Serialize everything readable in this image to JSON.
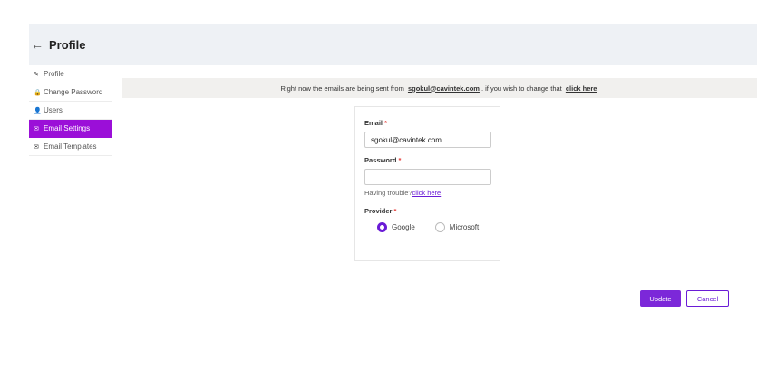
{
  "header": {
    "back_icon": "←",
    "title": "Profile"
  },
  "sidebar": {
    "items": [
      {
        "label": "Profile",
        "icon": "pencil-icon",
        "glyph": "✎",
        "active": false
      },
      {
        "label": "Change Password",
        "icon": "lock-icon",
        "glyph": "🔒",
        "active": false
      },
      {
        "label": "Users",
        "icon": "user-icon",
        "glyph": "👤",
        "active": false
      },
      {
        "label": "Email Settings",
        "icon": "envelope-icon",
        "glyph": "✉",
        "active": true
      },
      {
        "label": "Email Templates",
        "icon": "envelope-icon",
        "glyph": "✉",
        "active": false
      }
    ],
    "active_color": "#9b0fd8"
  },
  "notice": {
    "prefix": "Right now the emails are being sent from",
    "email": "sgokul@cavintek.com",
    "middle": ". if you wish to change that",
    "link": "click here"
  },
  "form": {
    "email_label": "Email",
    "email_value": "sgokul@cavintek.com",
    "password_label": "Password",
    "password_value": "",
    "required_mark": "*",
    "help_text": "Having trouble?",
    "help_link": "click here",
    "provider_label": "Provider",
    "providers": [
      {
        "label": "Google",
        "selected": true
      },
      {
        "label": "Microsoft",
        "selected": false
      }
    ]
  },
  "actions": {
    "update_label": "Update",
    "cancel_label": "Cancel"
  },
  "colors": {
    "accent": "#7c28d9",
    "header_bg": "#eef1f5",
    "notice_bg": "#f1f0ee"
  }
}
